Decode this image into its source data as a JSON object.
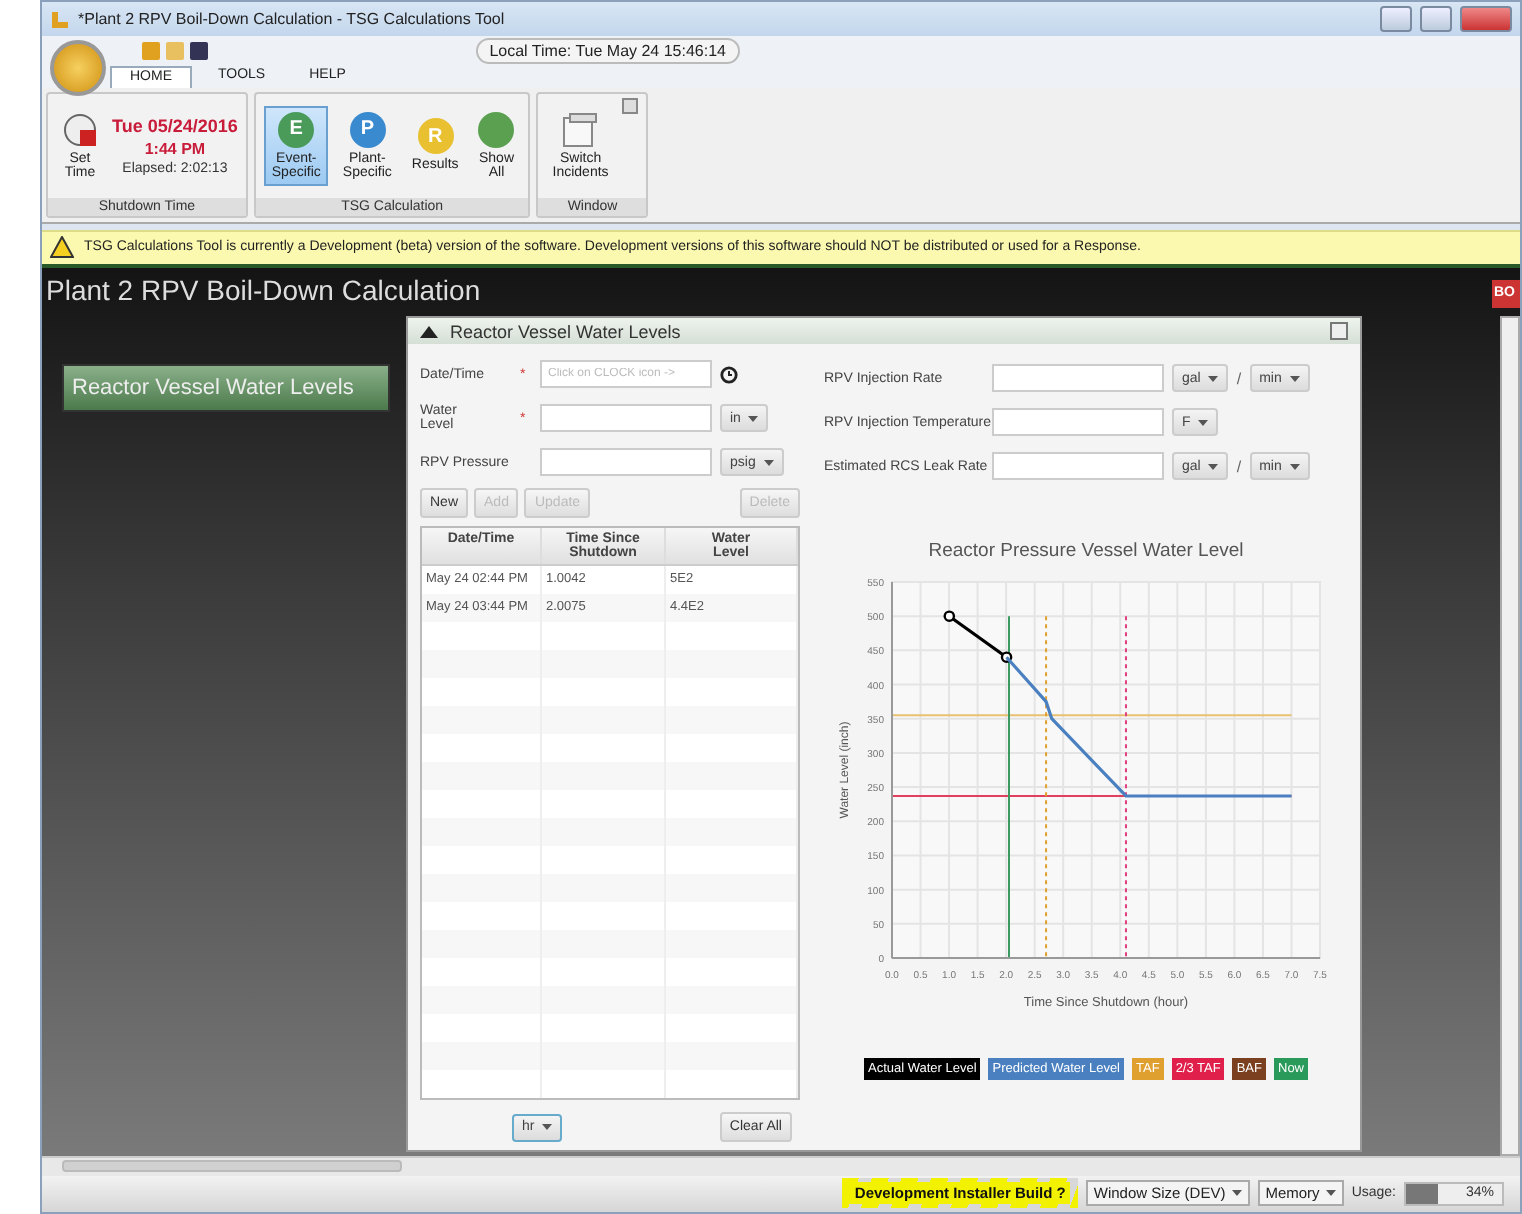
{
  "window": {
    "title": "*Plant 2 RPV Boil-Down Calculation - TSG Calculations Tool"
  },
  "local_time": "Local Time:  Tue May 24 15:46:14",
  "tabs": [
    {
      "label": "HOME",
      "selected": true
    },
    {
      "label": "TOOLS",
      "selected": false
    },
    {
      "label": "HELP",
      "selected": false
    }
  ],
  "shutdown_group": {
    "caption": "Shutdown Time",
    "set_time": "Set\nTime",
    "date": "Tue 05/24/2016",
    "time": "1:44 PM",
    "elapsed": "Elapsed: 2:02:13"
  },
  "tsg_group": {
    "caption": "TSG Calculation",
    "buttons": [
      {
        "label": "Event-\nSpecific",
        "letter": "E",
        "color": "#4a9a5a",
        "selected": true
      },
      {
        "label": "Plant-\nSpecific",
        "letter": "P",
        "color": "#3a8ad0",
        "selected": false
      },
      {
        "label": "Results",
        "letter": "R",
        "color": "#e8c030",
        "selected": false
      },
      {
        "label": "Show\nAll",
        "color": "#5aa050",
        "selected": false
      }
    ]
  },
  "window_group": {
    "caption": "Window",
    "switch": "Switch\nIncidents"
  },
  "warning": "TSG Calculations Tool is currently a Development (beta) version of the software. Development versions of this software should NOT be distributed or used for a Response.",
  "page_title": "Plant 2 RPV Boil-Down Calculation",
  "nav": [
    {
      "label": "Reactor Vessel Water Levels",
      "selected": true
    }
  ],
  "side_tab": "BO",
  "panel": {
    "title": "Reactor Vessel Water Levels",
    "left_fields": [
      {
        "label": "Date/Time",
        "required_mark": "*",
        "placeholder": "Click on CLOCK icon ->",
        "kind": "clock"
      },
      {
        "label": "Water\nLevel",
        "required_mark": "*",
        "kind": "unit",
        "unit": "in"
      },
      {
        "label": "RPV Pressure",
        "kind": "unit",
        "unit": "psig"
      }
    ],
    "actions": [
      {
        "label": "New",
        "disabled": false
      },
      {
        "label": "Add",
        "disabled": true
      },
      {
        "label": "Update",
        "disabled": true
      },
      {
        "label": "Delete",
        "disabled": true
      }
    ],
    "right_fields": [
      {
        "label": "RPV Injection Rate",
        "units": [
          "gal",
          "min"
        ],
        "separator": "/"
      },
      {
        "label": "RPV Injection Temperature",
        "units": [
          "F"
        ]
      },
      {
        "label": "Estimated RCS Leak Rate",
        "units": [
          "gal",
          "min"
        ],
        "separator": "/"
      }
    ],
    "table": {
      "columns": [
        "Date/Time",
        "Time Since\nShutdown",
        "Water\nLevel"
      ],
      "rows": [
        [
          "May 24 02:44 PM",
          "1.0042",
          "5E2"
        ],
        [
          "May 24 03:44 PM",
          "2.0075",
          "4.4E2"
        ]
      ]
    },
    "time_unit": "hr",
    "clear": "Clear All",
    "chart_data": {
      "type": "line",
      "title": "Reactor Pressure Vessel Water Level",
      "xlabel": "Time Since Shutdown (hour)",
      "ylabel": "Water Level (inch)",
      "x": [
        1.0042,
        2.0075,
        2.7,
        2.8,
        4.1,
        7.0
      ],
      "series": [
        {
          "name": "Actual Water Level",
          "color": "#000000",
          "marker": "o",
          "values": [
            500,
            440,
            null,
            null,
            null,
            null
          ]
        },
        {
          "name": "Predicted Water Level",
          "color": "#4a80c0",
          "values": [
            null,
            440,
            375,
            350,
            237,
            237
          ]
        }
      ],
      "xlim": [
        0,
        7.5
      ],
      "ylim": [
        0,
        550
      ],
      "xticks": [
        {
          "value": 0,
          "label": "0.0"
        },
        0.5,
        {
          "value": 1,
          "label": "1.0"
        },
        1.5,
        {
          "value": 2,
          "label": "2.0"
        },
        2.5,
        {
          "value": 3,
          "label": "3.0"
        },
        3.5,
        {
          "value": 4,
          "label": "4.0"
        },
        4.5,
        {
          "value": 5,
          "label": "5.0"
        },
        5.5,
        {
          "value": 6,
          "label": "6.0"
        },
        6.5,
        {
          "value": 7,
          "label": "7.0"
        },
        7.5
      ],
      "yticks": [
        0,
        50,
        100,
        150,
        200,
        250,
        300,
        350,
        400,
        450,
        500,
        550
      ],
      "grid": true,
      "ref_lines": [
        {
          "axis": "y",
          "value": 355,
          "color": "#e8c070"
        },
        {
          "axis": "y",
          "value": 237,
          "color": "#e04060"
        },
        {
          "axis": "x",
          "value": 2.05,
          "color": "#3a9a60"
        },
        {
          "axis": "x",
          "value": 2.7,
          "color": "#e0a030"
        },
        {
          "axis": "x",
          "value": 4.1,
          "color": "#e04080"
        }
      ]
    },
    "legend": [
      {
        "label": "TAF",
        "color": "#e0a030"
      },
      {
        "label": "2/3 TAF",
        "color": "#e0204a"
      },
      {
        "label": "BAF",
        "color": "#7a4020"
      },
      {
        "label": "Now",
        "color": "#2a9a5a"
      }
    ]
  },
  "status_bar": {
    "build": "Development Installer Build ?",
    "window_size": "Window Size (DEV)",
    "memory": "Memory",
    "usage_label": "Usage:",
    "usage": {
      "level": 0.34
    },
    "usage_text": "34%"
  }
}
